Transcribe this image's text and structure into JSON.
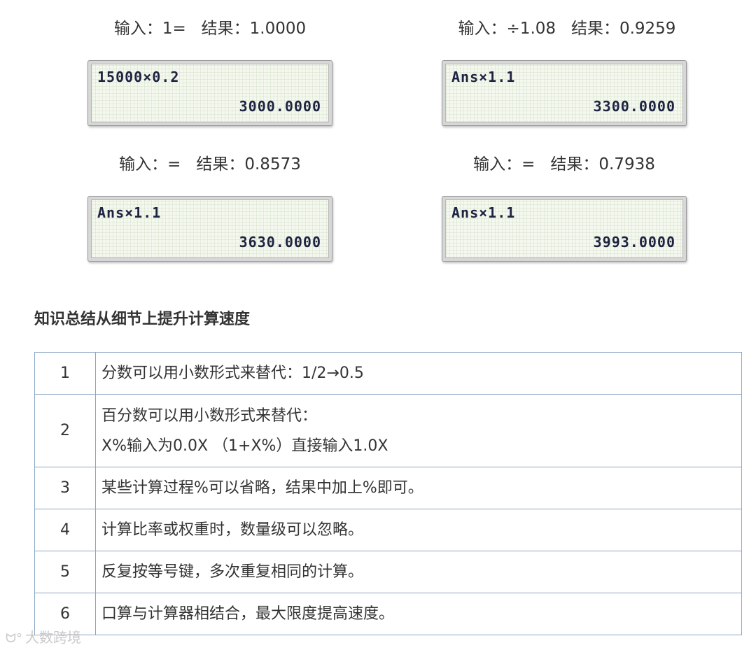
{
  "calculators": [
    {
      "caption": "输入：1=   结果：1.0000",
      "expression": "15000×0.2",
      "result": "3000.0000"
    },
    {
      "caption": "输入：÷1.08   结果：0.9259",
      "expression": "Ans×1.1",
      "result": "3300.0000"
    },
    {
      "caption": "输入：=   结果：0.8573",
      "expression": "Ans×1.1",
      "result": "3630.0000"
    },
    {
      "caption": "输入：=   结果：0.7938",
      "expression": "Ans×1.1",
      "result": "3993.0000"
    }
  ],
  "section_title": "知识总结从细节上提升计算速度",
  "tips": [
    {
      "num": "1",
      "lines": [
        "分数可以用小数形式来替代：1/2→0.5"
      ]
    },
    {
      "num": "2",
      "lines": [
        "百分数可以用小数形式来替代：",
        "X%输入为0.0X （1+X%）直接输入1.0X"
      ]
    },
    {
      "num": "3",
      "lines": [
        "某些计算过程%可以省略，结果中加上%即可。"
      ]
    },
    {
      "num": "4",
      "lines": [
        "计算比率或权重时，数量级可以忽略。"
      ]
    },
    {
      "num": "5",
      "lines": [
        "反复按等号键，多次重复相同的计算。"
      ]
    },
    {
      "num": "6",
      "lines": [
        "口算与计算器相结合，最大限度提高速度。"
      ]
    }
  ],
  "watermark": {
    "icon": "owl-logo-icon",
    "text": "大数跨境"
  }
}
